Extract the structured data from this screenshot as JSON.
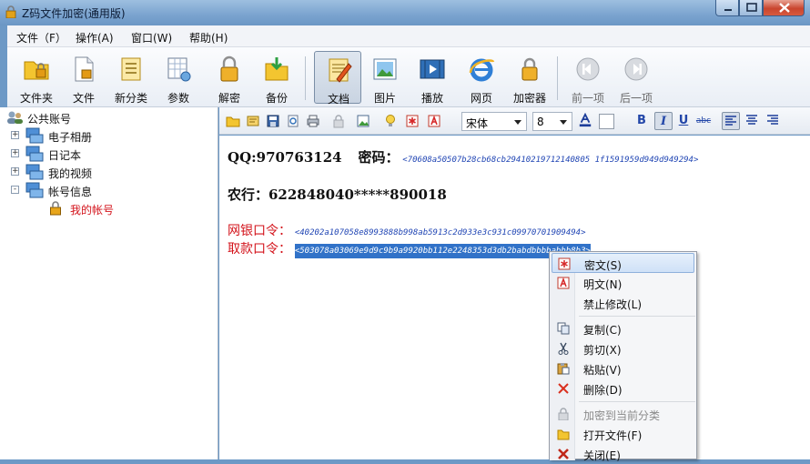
{
  "window": {
    "title": "Z码文件加密(通用版)"
  },
  "menu": [
    "文件（F）",
    "操作(A)",
    "窗口(W)",
    "帮助(H)"
  ],
  "toolbar": {
    "folder": "文件夹",
    "file": "文件",
    "new_category": "新分类",
    "params": "参数",
    "decrypt": "解密",
    "backup": "备份",
    "document": "文档",
    "picture": "图片",
    "play": "播放",
    "webpage": "网页",
    "encryptor": "加密器",
    "prev": "前一项",
    "next": "后一项"
  },
  "tree": {
    "root": "公共账号",
    "items": [
      {
        "label": "电子相册",
        "expander": "+"
      },
      {
        "label": "日记本",
        "expander": "+"
      },
      {
        "label": "我的视频",
        "expander": "+"
      },
      {
        "label": "帐号信息",
        "expander": "-"
      }
    ],
    "child": "我的帐号"
  },
  "editor_toolbar": {
    "font": "宋体",
    "size": "8",
    "bold": "B",
    "italic": "I",
    "underline": "U",
    "strike": "abc"
  },
  "document": {
    "qq_label": "QQ:970763124",
    "pwd_label": "密码：",
    "pwd_cipher": "<70608a50507b28cb68cb29410219712140805 1f1591959d949d949294>",
    "bank_line": "农行：622848040*****890018",
    "online_label": "网银口令：",
    "online_cipher": "<40202a107058e8993888b998ab5913c2d933e3c931c09970701909494>",
    "withdraw_label": "取款口令：",
    "withdraw_cipher": "<503078a03069e9d9c9b9a9920bb112e2248353d3db2babdbbbbabbb8b3>"
  },
  "context_menu": {
    "cipher": "密文(S)",
    "plain": "明文(N)",
    "no_edit": "禁止修改(L)",
    "copy": "复制(C)",
    "cut": "剪切(X)",
    "paste": "粘贴(V)",
    "delete": "删除(D)",
    "encrypt_to_category": "加密到当前分类",
    "open_file": "打开文件(F)",
    "close": "关闭(E)"
  }
}
